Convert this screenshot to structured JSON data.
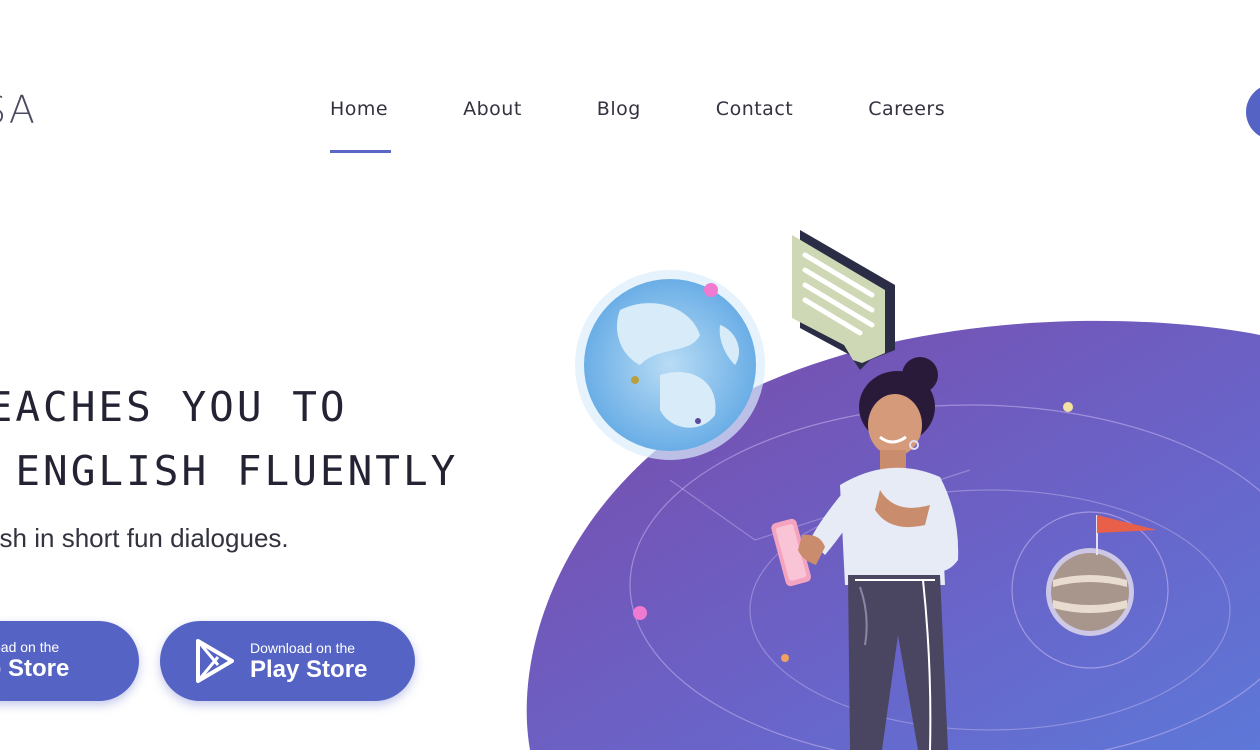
{
  "logo": {
    "text": "SA"
  },
  "nav": {
    "items": [
      {
        "label": "Home"
      },
      {
        "label": "About"
      },
      {
        "label": "Blog"
      },
      {
        "label": "Contact"
      },
      {
        "label": "Careers"
      }
    ],
    "active": "Home"
  },
  "hero": {
    "title_line1": "TEACHES YOU TO",
    "title_line2": "K ENGLISH FLUENTLY",
    "subtitle": "lish in short fun dialogues."
  },
  "buttons": {
    "app_store": {
      "small": "wnload on the",
      "big": "pp Store"
    },
    "play_store": {
      "small": "Download on the",
      "big": "Play Store"
    }
  },
  "colors": {
    "accent": "#5563c4",
    "blob_start": "#7a4aa8",
    "blob_end": "#5d78d8",
    "text": "#232333"
  },
  "icons": [
    "play-store-icon",
    "globe-icon",
    "speech-bubble-icon",
    "planet-icon",
    "flag-icon"
  ]
}
